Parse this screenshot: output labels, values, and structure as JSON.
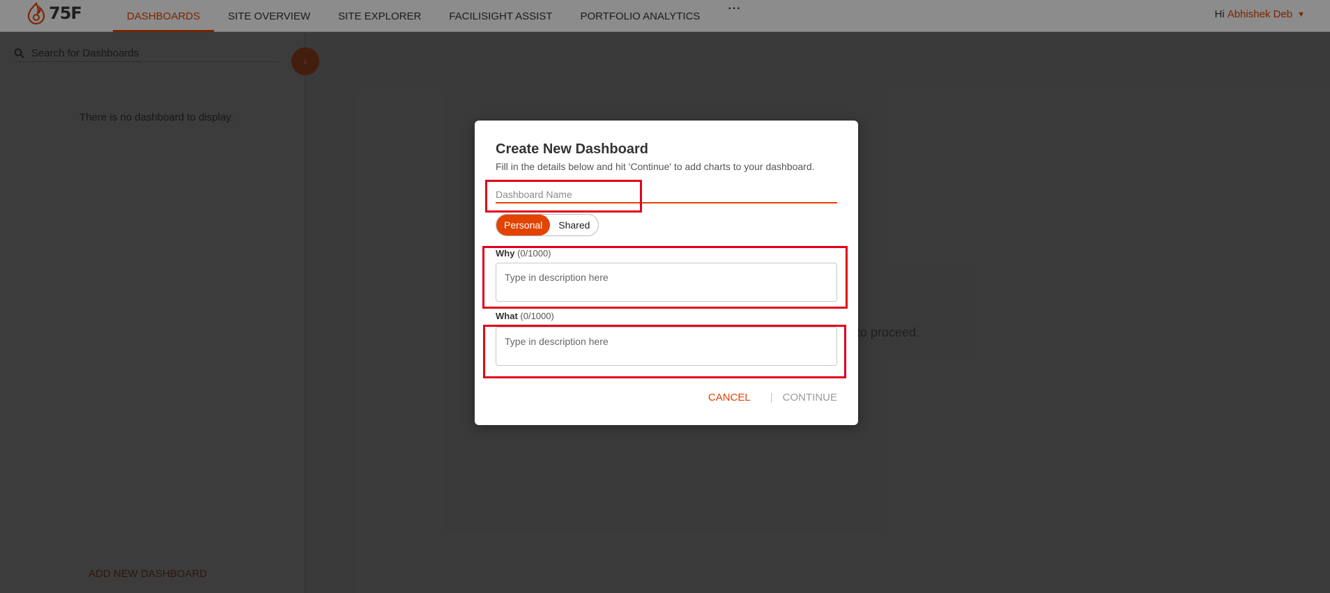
{
  "app": {
    "logo_text": "75F"
  },
  "nav": {
    "items": [
      {
        "label": "DASHBOARDS"
      },
      {
        "label": "SITE OVERVIEW"
      },
      {
        "label": "SITE EXPLORER"
      },
      {
        "label": "FACILISIGHT ASSIST"
      },
      {
        "label": "PORTFOLIO ANALYTICS"
      }
    ],
    "more": "···"
  },
  "user": {
    "greeting": "Hi",
    "name": "Abhishek Deb"
  },
  "sidebar": {
    "search_placeholder": "Search for Dashboards",
    "empty_text": "There is no dashboard to display.",
    "add_new": "ADD NEW DASHBOARD"
  },
  "main": {
    "hint_fragment": "to proceed."
  },
  "modal": {
    "title": "Create New Dashboard",
    "subtitle": "Fill in the details below and hit 'Continue' to add charts to your dashboard.",
    "name_placeholder": "Dashboard Name",
    "toggle": {
      "personal": "Personal",
      "shared": "Shared",
      "selected": "Personal"
    },
    "why": {
      "label": "Why",
      "count": "(0/1000)",
      "placeholder": "Type in description here"
    },
    "what": {
      "label": "What",
      "count": "(0/1000)",
      "placeholder": "Type in description here"
    },
    "cancel": "CANCEL",
    "continue": "CONTINUE"
  },
  "colors": {
    "accent": "#e24301",
    "annotation": "#e3001b"
  },
  "icons": {
    "logo": "flame-logo-icon",
    "search": "search-icon",
    "chevron": "chevron-down-icon",
    "collapse": "chevron-left-icon"
  }
}
